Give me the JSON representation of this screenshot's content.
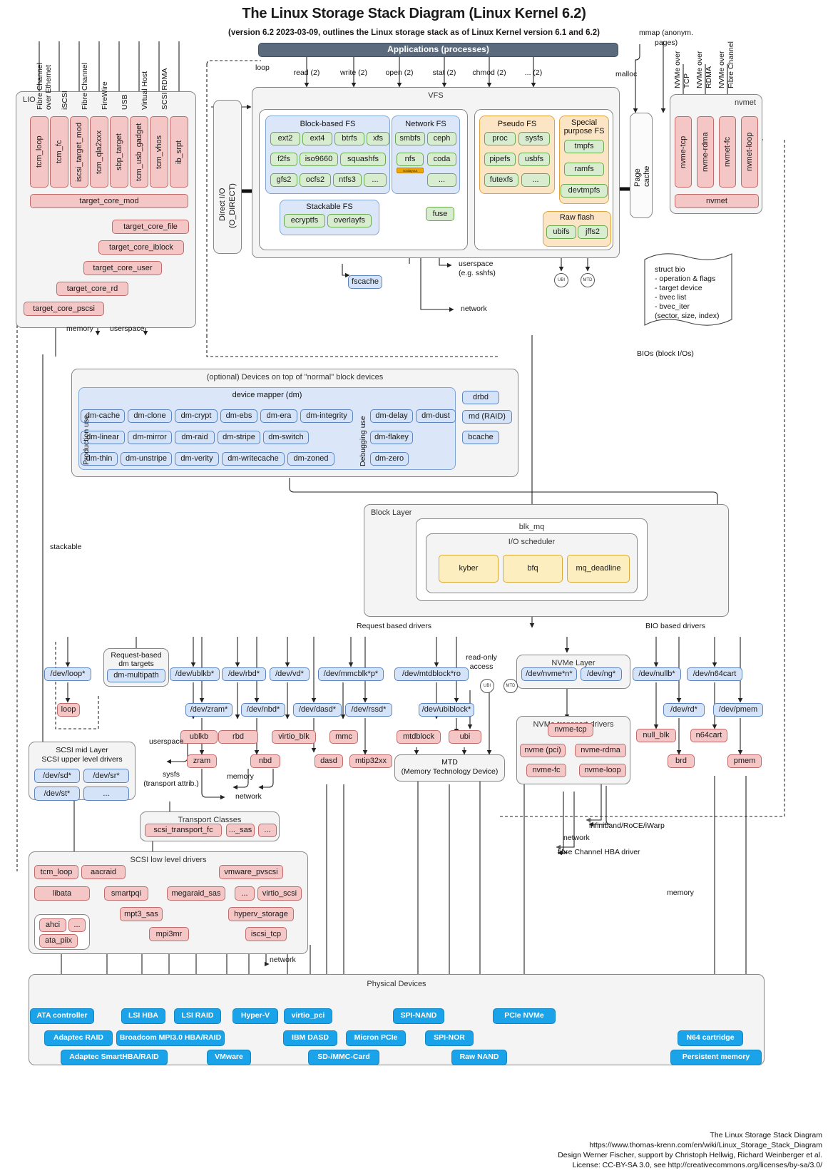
{
  "title": "The Linux Storage Stack Diagram (Linux Kernel 6.2)",
  "subtitle": "(version 6.2 2023-03-09, outlines the Linux storage stack as of Linux Kernel version 6.1 and 6.2)",
  "applications": {
    "label": "Applications (processes)"
  },
  "syscalls": [
    "read (2)",
    "write (2)",
    "open (2)",
    "stat (2)",
    "chmod (2)",
    "... (2)"
  ],
  "mmap_label": "mmap (anonym.\npages)",
  "mmap_line1": "mmap (anonym.",
  "mmap_line2": "pages)",
  "malloc_label": "malloc",
  "loop_label": "loop",
  "page_cache": "Page\ncache",
  "page_cache_l1": "Page",
  "page_cache_l2": "cache",
  "direct_io_l1": "Direct I/O",
  "direct_io_l2": "(O_DIRECT)",
  "lio": {
    "label": "LIO",
    "transports": [
      "Fibre Channel\nover Ethernet",
      "iSCSI",
      "Fibre Channel",
      "FireWire",
      "USB",
      "Virtual Host",
      "SCSI RDMA"
    ],
    "transport_labels": [
      [
        "Fibre Channel",
        "over Ethernet"
      ],
      [
        "iSCSI"
      ],
      [
        "Fibre Channel"
      ],
      [
        "FireWire"
      ],
      [
        "USB"
      ],
      [
        "Virtual Host"
      ],
      [
        "SCSI RDMA"
      ]
    ],
    "fabric_modules": [
      "tcm_loop",
      "tcm_fc",
      "iscsi_target_mod",
      "tcm_qla2xxx",
      "sbp_target",
      "tcm_usb_gadget",
      "tcm_vhos",
      "ib_srpt"
    ],
    "core": "target_core_mod",
    "backends": [
      "target_core_file",
      "target_core_iblock",
      "target_core_user",
      "target_core_rd",
      "target_core_pscsi"
    ],
    "out_memory": "memory",
    "out_userspace": "userspace"
  },
  "vfs": {
    "label": "VFS",
    "block_fs": {
      "label": "Block-based FS",
      "items": [
        "ext2",
        "ext4",
        "btrfs",
        "xfs",
        "f2fs",
        "iso9660",
        "squashfs",
        "gfs2",
        "ocfs2",
        "ntfs3",
        "..."
      ]
    },
    "stackable_fs": {
      "label": "Stackable FS",
      "items": [
        "ecryptfs",
        "overlayfs"
      ]
    },
    "network_fs": {
      "label": "Network FS",
      "items": [
        "smbfs",
        "ceph",
        "nfs",
        "coda",
        "..."
      ],
      "badge": "scsilayout"
    },
    "fuse": "fuse",
    "pseudo_fs": {
      "label": "Pseudo FS",
      "items": [
        "proc",
        "sysfs",
        "pipefs",
        "usbfs",
        "futexfs",
        "..."
      ]
    },
    "special_fs": {
      "label": "Special\npurpose FS",
      "label_l1": "Special",
      "label_l2": "purpose FS",
      "items": [
        "tmpfs",
        "ramfs",
        "devtmpfs"
      ]
    },
    "raw_flash": {
      "label": "Raw flash",
      "items": [
        "ubifs",
        "jffs2"
      ]
    },
    "fscache": "fscache",
    "out_userspace_l1": "userspace",
    "out_userspace_l2": "(e.g. sshfs)",
    "out_network": "network"
  },
  "nvmet": {
    "label": "nvmet",
    "transports": [
      [
        "NVMe over",
        "TCP"
      ],
      [
        "NVMe over",
        "RDMA"
      ],
      [
        "NVMe over",
        "Fibre Channel"
      ]
    ],
    "modules": [
      "nvme-tcp",
      "nvme-rdma",
      "nvmet-fc",
      "nvmet-loop"
    ],
    "core": "nvmet"
  },
  "struct_bio": {
    "lines": [
      "struct bio",
      "- operation & flags",
      "- target device",
      "- bvec list",
      "- bvec_iter",
      "   (sector, size, index)"
    ]
  },
  "bios_label": "BIOs (block I/Os)",
  "stackable_label": "stackable",
  "optional_devices": {
    "label": "(optional) Devices on top of \"normal\" block devices",
    "dm": {
      "label": "device mapper (dm)",
      "production_label": "Production use",
      "debugging_label": "Debugging use",
      "production": [
        [
          "dm-cache",
          "dm-clone",
          "dm-crypt",
          "dm-ebs",
          "dm-era",
          "dm-integrity"
        ],
        [
          "dm-linear",
          "dm-mirror",
          "dm-raid",
          "dm-stripe",
          "dm-switch"
        ],
        [
          "dm-thin",
          "dm-unstripe",
          "dm-verity",
          "dm-writecache",
          "dm-zoned"
        ]
      ],
      "debugging": [
        [
          "dm-delay",
          "dm-dust"
        ],
        [
          "dm-flakey"
        ],
        [
          "dm-zero"
        ]
      ]
    },
    "others": [
      "drbd",
      "md (RAID)",
      "bcache"
    ]
  },
  "block_layer": {
    "label": "Block Layer",
    "blk_mq": "blk_mq",
    "io_scheduler": "I/O scheduler",
    "schedulers": [
      "kyber",
      "bfq",
      "mq_deadline"
    ]
  },
  "driver_labels": {
    "request_based": "Request based drivers",
    "bio_based": "BIO based drivers",
    "read_only_l1": "read-only",
    "read_only_l2": "access"
  },
  "request_dm": {
    "label_l1": "Request-based",
    "label_l2": "dm targets",
    "item": "dm-multipath"
  },
  "devnodes": [
    "/dev/loop*",
    "/dev/ublkb*",
    "/dev/rbd*",
    "/dev/vd*",
    "/dev/mmcblk*p*",
    "/dev/mtdblock*ro",
    "/dev/zram*",
    "/dev/nbd*",
    "/dev/dasd*",
    "/dev/rssd*",
    "/dev/ubiblock*",
    "/dev/nullb*",
    "/dev/n64cart",
    "/dev/rd*",
    "/dev/pmem"
  ],
  "drivers_mid": [
    "loop",
    "ublkb",
    "rbd",
    "virtio_blk",
    "mmc",
    "mtdblock",
    "ubi",
    "zram",
    "nbd",
    "dasd",
    "mtip32xx",
    "null_blk",
    "n64cart",
    "brd",
    "pmem"
  ],
  "nvme_layer": {
    "label": "NVMe Layer",
    "items": [
      "/dev/nvme*n*",
      "/dev/ng*"
    ]
  },
  "nvme_transport": {
    "label": "NVMe transport drivers",
    "items": [
      "nvme-tcp",
      "nvme (pci)",
      "nvme-rdma",
      "nvme-fc",
      "nvme-loop"
    ]
  },
  "mtd": {
    "l1": "MTD",
    "l2": "(Memory Technology Device)"
  },
  "scsi_mid": {
    "l1": "SCSI mid Layer",
    "l2": "SCSI upper level drivers",
    "items": [
      "/dev/sd*",
      "/dev/sr*",
      "/dev/st*",
      "..."
    ]
  },
  "transport_classes": {
    "label": "Transport Classes",
    "items": [
      "scsi_transport_fc",
      "..._sas",
      "..."
    ]
  },
  "scsi_low": {
    "label": "SCSI low level drivers",
    "items": [
      "tcm_loop",
      "aacraid",
      "vmware_pvscsi",
      "libata",
      "smartpqi",
      "megaraid_sas",
      "...",
      "virtio_scsi",
      "mpt3_sas",
      "hyperv_storage",
      "mpi3mr",
      "iscsi_tcp"
    ],
    "libata_children": [
      "ahci",
      "...",
      "ata_piix"
    ]
  },
  "physical": {
    "label": "Physical Devices",
    "items": [
      "ATA controller",
      "LSI HBA",
      "LSI RAID",
      "Hyper-V",
      "virtio_pci",
      "SPI-NAND",
      "PCIe NVMe",
      "Adaptec RAID",
      "Broadcom MPI3.0 HBA/RAID",
      "IBM DASD",
      "Micron PCIe",
      "SPI-NOR",
      "N64 cartridge",
      "Adaptec SmartHBA/RAID",
      "VMware",
      "SD-/MMC-Card",
      "Raw NAND",
      "Persistent memory"
    ]
  },
  "annotations": {
    "userspace": "userspace",
    "memory": "memory",
    "network": "network",
    "sysfs_l1": "sysfs",
    "sysfs_l2": "(transport attrib.)",
    "infiniband": "infiniband/RoCE/iWarp",
    "fc_hba": "fibre Channel HBA driver"
  },
  "footer": [
    "The Linux Storage Stack Diagram",
    "https://www.thomas-krenn.com/en/wiki/Linux_Storage_Stack_Diagram",
    "Design Werner Fischer, support by Christoph Hellwig, Richard Weinberger et al.",
    "License: CC-BY-SA 3.0, see http://creativecommons.org/licenses/by-sa/3.0/"
  ],
  "colors": {
    "red": "#f5c6c6",
    "blue": "#d4e3f7",
    "green": "#d8ecd0",
    "orange": "#fde8c8",
    "yellow": "#fdeec0",
    "cyan": "#1aa3e8",
    "dark": "#5b6b7d"
  }
}
